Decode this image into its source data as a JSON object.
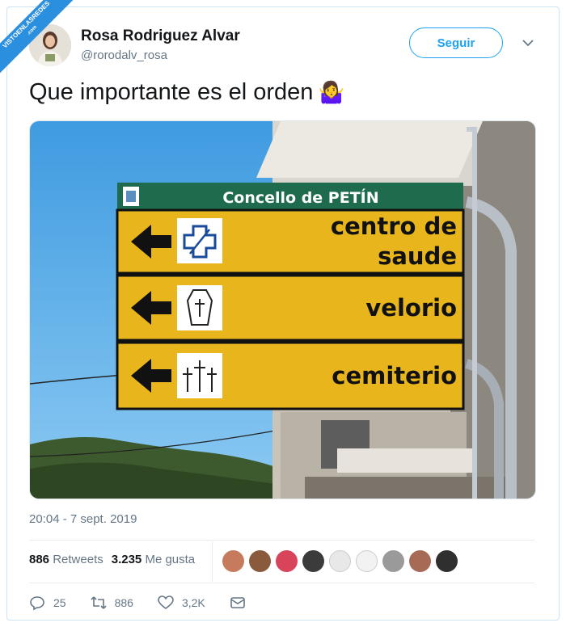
{
  "watermark": {
    "line1": "VISTOENLASREDES",
    "line2": ".com"
  },
  "author": {
    "name": "Rosa Rodriguez Alvar",
    "handle": "@rorodalv_rosa"
  },
  "follow_label": "Seguir",
  "tweet": {
    "text": "Que importante es el orden",
    "emoji": "🤷‍♀️"
  },
  "sign": {
    "header": "Concello de PETÍN",
    "rows": [
      {
        "line1": "centro de",
        "line2": "saude",
        "icon": "health-cross-icon"
      },
      {
        "line1": "velorio",
        "line2": "",
        "icon": "coffin-icon"
      },
      {
        "line1": "cemiterio",
        "line2": "",
        "icon": "crosses-icon"
      }
    ],
    "colors": {
      "green": "#1f6b4e",
      "yellow": "#e8b61c",
      "sky": "#4aa3e3"
    }
  },
  "timestamp": "20:04 - 7 sept. 2019",
  "stats": {
    "retweets": "886",
    "retweets_label": "Retweets",
    "likes": "3.235",
    "likes_label": "Me gusta"
  },
  "likers": [
    "#c67b5c",
    "#8a5a3c",
    "#d8455b",
    "#3b3b3b",
    "#e8e8e8",
    "#f2f2f2",
    "#9a9a9a",
    "#a56b54",
    "#2f2f2f"
  ],
  "actions": {
    "replies": "25",
    "retweets": "886",
    "likes": "3,2K"
  }
}
